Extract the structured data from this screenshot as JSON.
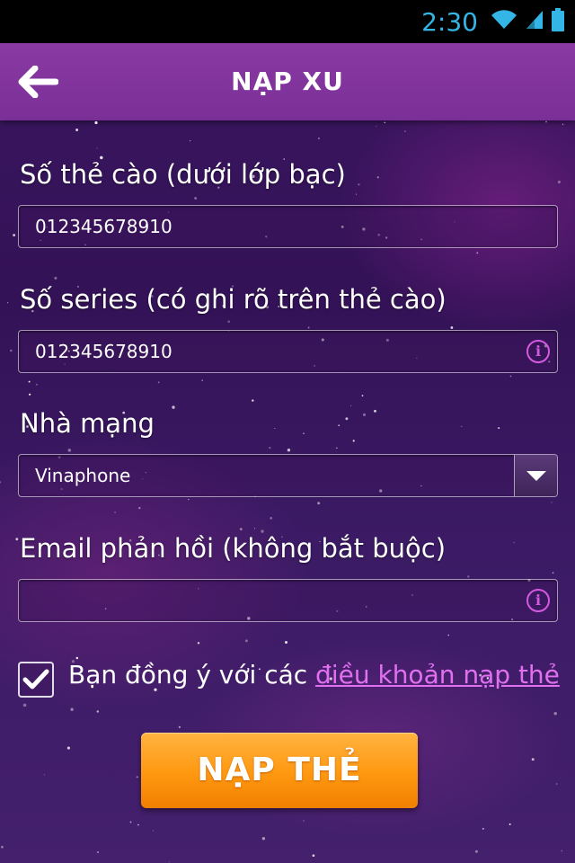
{
  "status_bar": {
    "time": "2:30",
    "icons": [
      "wifi-icon",
      "signal-icon",
      "battery-icon"
    ]
  },
  "app_bar": {
    "back_icon": "arrow-left-icon",
    "title": "NẠP XU"
  },
  "form": {
    "card_number": {
      "label": "Số thẻ cào (dưới lớp bạc)",
      "value": "012345678910"
    },
    "serial_number": {
      "label": "Số series (có ghi rõ trên thẻ cào)",
      "value": "012345678910",
      "icon": "info-icon"
    },
    "carrier": {
      "label": "Nhà mạng",
      "value": "Vinaphone",
      "icon": "dropdown-arrow-icon"
    },
    "email": {
      "label": "Email phản hồi (không bắt buộc)",
      "value": "",
      "icon": "info-icon"
    },
    "agreement": {
      "checked": true,
      "text": "Bạn đồng ý với các ",
      "link": "điều khoản nạp thẻ"
    },
    "submit_label": "NẠP THẺ"
  },
  "colors": {
    "accent": "#d35ae0",
    "button": "#ff9810",
    "status_text": "#33b5e5",
    "app_bar": "#7a2f97"
  }
}
